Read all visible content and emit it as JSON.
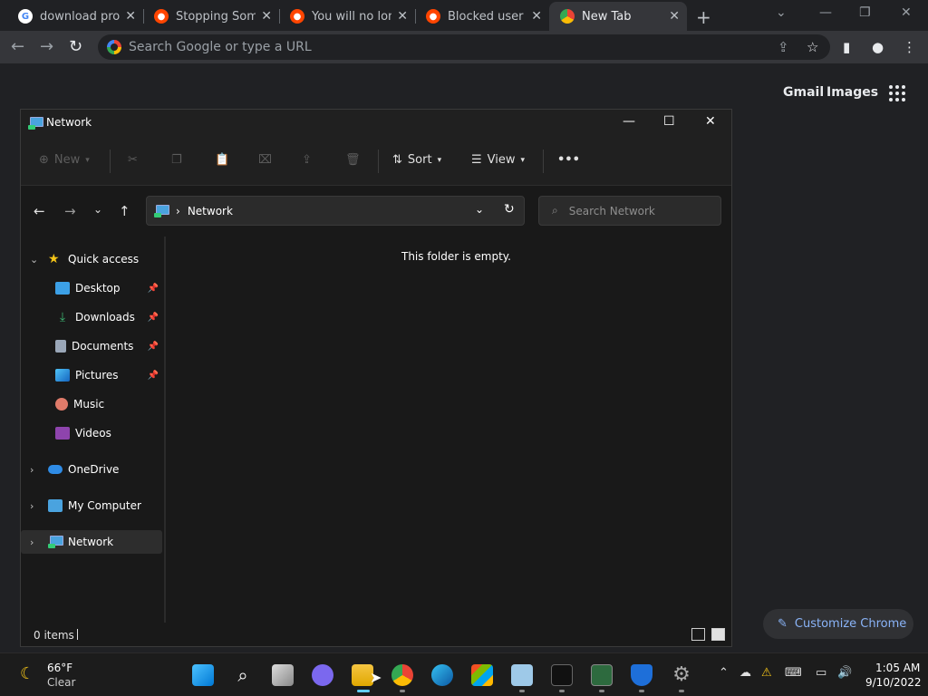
{
  "browser": {
    "tabs": [
      {
        "title": "download proce",
        "favicon": "google-icon",
        "active": false
      },
      {
        "title": "Stopping Some",
        "favicon": "reddit-icon",
        "active": false
      },
      {
        "title": "You will no long",
        "favicon": "reddit-icon",
        "active": false
      },
      {
        "title": "Blocked user ge",
        "favicon": "reddit-icon",
        "active": false
      },
      {
        "title": "New Tab",
        "favicon": "chrome-icon",
        "active": true
      }
    ],
    "new_tab_glyph": "+",
    "close_glyph": "✕",
    "omnibox_placeholder": "Search Google or type a URL",
    "ntp": {
      "gmail": "Gmail",
      "images": "Images",
      "customize": "Customize Chrome"
    }
  },
  "explorer": {
    "title": "Network",
    "commands": {
      "new": "New",
      "sort": "Sort",
      "view": "View",
      "more": "•••"
    },
    "address": {
      "breadcrumb": "Network",
      "search_placeholder": "Search Network"
    },
    "nav": {
      "quick_access": "Quick access",
      "items": [
        {
          "label": "Desktop",
          "icon": "desktop-icon",
          "pinned": true
        },
        {
          "label": "Downloads",
          "icon": "downloads-icon",
          "pinned": true
        },
        {
          "label": "Documents",
          "icon": "documents-icon",
          "pinned": true
        },
        {
          "label": "Pictures",
          "icon": "pictures-icon",
          "pinned": true
        },
        {
          "label": "Music",
          "icon": "music-icon",
          "pinned": false
        },
        {
          "label": "Videos",
          "icon": "videos-icon",
          "pinned": false
        }
      ],
      "onedrive": "OneDrive",
      "my_computer": "My Computer",
      "network": "Network"
    },
    "empty_message": "This folder is empty.",
    "status": "0 items"
  },
  "taskbar": {
    "weather_temp": "66°F",
    "weather_cond": "Clear",
    "time": "1:05 AM",
    "date": "9/10/2022"
  },
  "colors": {
    "chrome_bg": "#202124",
    "explorer_bg": "#191919",
    "accent_blue": "#8ab4f8"
  }
}
